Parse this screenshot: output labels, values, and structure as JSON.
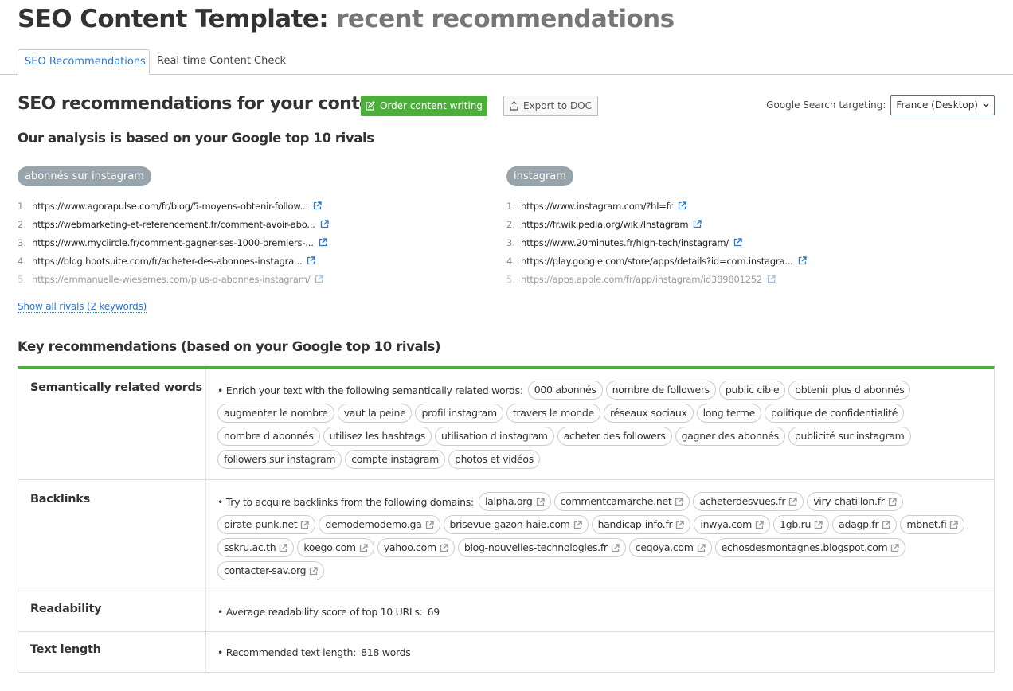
{
  "page": {
    "title_main": "SEO Content Template:",
    "title_sub": "recent recommendations"
  },
  "tabs": [
    {
      "label": "SEO Recommendations",
      "active": true
    },
    {
      "label": "Real-time Content Check",
      "active": false
    }
  ],
  "header": {
    "section_title": "SEO recommendations for your content",
    "order_button": "Order content writing",
    "export_button": "Export to DOC",
    "targeting_label": "Google Search targeting:",
    "targeting_value": "France (Desktop)"
  },
  "analysis_title": "Our analysis is based on your Google top 10 rivals",
  "keywords": [
    {
      "keyword": "abonnés sur instagram",
      "rivals": [
        {
          "num": "1.",
          "url": "https://www.agorapulse.com/fr/blog/5-moyens-obtenir-follow..."
        },
        {
          "num": "2.",
          "url": "https://webmarketing-et-referencement.fr/comment-avoir-abo..."
        },
        {
          "num": "3.",
          "url": "https://www.myciircle.fr/comment-gagner-ses-1000-premiers-..."
        },
        {
          "num": "4.",
          "url": "https://blog.hootsuite.com/fr/acheter-des-abonnes-instagra..."
        },
        {
          "num": "5.",
          "url": "https://emmanuelle-wiesemes.com/plus-d-abonnes-instagram/"
        }
      ]
    },
    {
      "keyword": "instagram",
      "rivals": [
        {
          "num": "1.",
          "url": "https://www.instagram.com/?hl=fr"
        },
        {
          "num": "2.",
          "url": "https://fr.wikipedia.org/wiki/Instagram"
        },
        {
          "num": "3.",
          "url": "https://www.20minutes.fr/high-tech/instagram/"
        },
        {
          "num": "4.",
          "url": "https://play.google.com/store/apps/details?id=com.instagra..."
        },
        {
          "num": "5.",
          "url": "https://apps.apple.com/fr/app/instagram/id389801252"
        }
      ]
    }
  ],
  "show_all_link": "Show all rivals (2 keywords)",
  "key_title": "Key recommendations (based on your Google top 10 rivals)",
  "recommendations": {
    "semantic": {
      "label": "Semantically related words",
      "text": "• Enrich your text with the following semantically related words:",
      "words": [
        "000 abonnés",
        "nombre de followers",
        "public cible",
        "obtenir plus d abonnés",
        "augmenter le nombre",
        "vaut la peine",
        "profil instagram",
        "travers le monde",
        "réseaux sociaux",
        "long terme",
        "politique de confidentialité",
        "nombre d abonnés",
        "utilisez les hashtags",
        "utilisation d instagram",
        "acheter des followers",
        "gagner des abonnés",
        "publicité sur instagram",
        "followers sur instagram",
        "compte instagram",
        "photos et vidéos"
      ]
    },
    "backlinks": {
      "label": "Backlinks",
      "text": "• Try to acquire backlinks from the following domains:",
      "domains": [
        "lalpha.org",
        "commentcamarche.net",
        "acheterdesvues.fr",
        "viry-chatillon.fr",
        "pirate-punk.net",
        "demodemodemo.ga",
        "brisevue-gazon-haie.com",
        "handicap-info.fr",
        "inwya.com",
        "1gb.ru",
        "adagp.fr",
        "mbnet.fi",
        "sskru.ac.th",
        "koego.com",
        "yahoo.com",
        "blog-nouvelles-technologies.fr",
        "ceqoya.com",
        "echosdesmontagnes.blogspot.com",
        "contacter-sav.org"
      ]
    },
    "readability": {
      "label": "Readability",
      "text": "• Average readability score of top 10 URLs:",
      "value": "69"
    },
    "text_length": {
      "label": "Text length",
      "text": "• Recommended text length:",
      "value": "818 words"
    }
  },
  "colors": {
    "accent_green": "#4caf3a",
    "link_blue": "#2f78c8",
    "badge_gray": "#97a4ab"
  },
  "icons": {
    "order": "edit-icon",
    "export": "upload-icon",
    "select": "chevron-down-icon",
    "external": "external-link-icon"
  }
}
